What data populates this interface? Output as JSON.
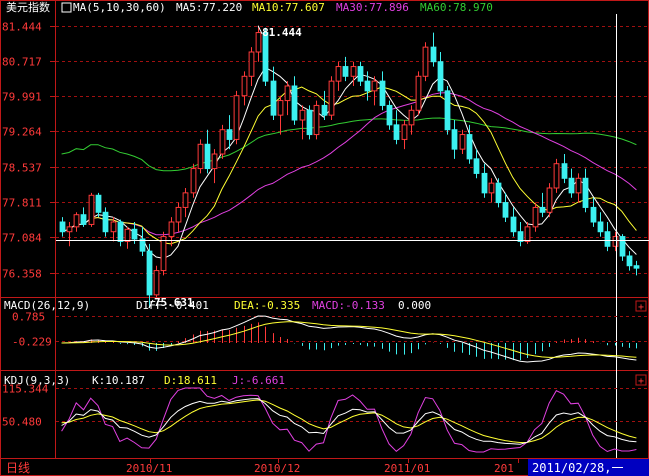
{
  "chart_data": {
    "type": "candlestick",
    "instrument": "美元指数",
    "panels": {
      "price": {
        "header": {
          "name": "美元指数",
          "ma_label": "MA(5,10,30,60)",
          "ma5": "MA5:77.220",
          "ma10": "MA10:77.607",
          "ma30": "MA30:77.896",
          "ma60": "MA60:78.970"
        },
        "y_ticks": [
          "81.444",
          "80.717",
          "79.991",
          "79.264",
          "78.537",
          "77.811",
          "77.084",
          "76.358"
        ],
        "y_range": [
          76.0,
          81.6
        ],
        "high_label": "81.444",
        "low_label": "75.631"
      },
      "macd": {
        "header": {
          "name": "MACD(26,12,9)",
          "diff": "DIFF:-0.401",
          "dea": "DEA:-0.335",
          "macd": "MACD:-0.133",
          "extra": "0.000"
        },
        "y_ticks": [
          "0.785",
          "-0.229"
        ]
      },
      "kdj": {
        "header": {
          "name": "KDJ(9,3,3)",
          "k": "K:10.187",
          "d": "D:18.611",
          "j": "J:-6.661"
        },
        "y_ticks": [
          "115.344",
          "50.480"
        ]
      }
    },
    "x_tick_labels": [
      "2010/11",
      "2010/12",
      "2011/01",
      "201"
    ],
    "cursor_date": "2011/02/28,一",
    "period_label": "日线",
    "candles_ohlc": [
      [
        77.4,
        77.5,
        77.1,
        77.2
      ],
      [
        77.2,
        77.4,
        76.9,
        77.3
      ],
      [
        77.3,
        77.6,
        77.2,
        77.55
      ],
      [
        77.55,
        77.7,
        77.3,
        77.35
      ],
      [
        77.35,
        78.0,
        77.3,
        77.95
      ],
      [
        77.95,
        78.0,
        77.5,
        77.6
      ],
      [
        77.6,
        77.7,
        77.1,
        77.2
      ],
      [
        77.2,
        77.5,
        77.0,
        77.4
      ],
      [
        77.4,
        77.45,
        76.9,
        77.0
      ],
      [
        77.0,
        77.3,
        76.85,
        77.25
      ],
      [
        77.25,
        77.4,
        76.95,
        77.05
      ],
      [
        77.05,
        77.3,
        76.7,
        76.8
      ],
      [
        76.8,
        76.95,
        75.63,
        75.9
      ],
      [
        75.9,
        76.5,
        75.85,
        76.4
      ],
      [
        76.4,
        77.2,
        76.3,
        77.1
      ],
      [
        77.1,
        77.5,
        76.9,
        77.4
      ],
      [
        77.4,
        77.8,
        77.2,
        77.7
      ],
      [
        77.7,
        78.1,
        77.5,
        78.0
      ],
      [
        78.0,
        78.6,
        77.9,
        78.5
      ],
      [
        78.5,
        79.1,
        78.4,
        79.0
      ],
      [
        79.0,
        79.3,
        78.4,
        78.5
      ],
      [
        78.5,
        78.9,
        78.2,
        78.8
      ],
      [
        78.8,
        79.4,
        78.7,
        79.3
      ],
      [
        79.3,
        79.6,
        78.9,
        79.1
      ],
      [
        79.1,
        80.1,
        79.0,
        80.0
      ],
      [
        80.0,
        80.5,
        79.8,
        80.4
      ],
      [
        80.4,
        81.0,
        80.2,
        80.9
      ],
      [
        80.9,
        81.44,
        80.7,
        81.3
      ],
      [
        81.3,
        81.4,
        80.2,
        80.3
      ],
      [
        80.3,
        80.6,
        79.5,
        79.6
      ],
      [
        79.6,
        80.0,
        79.2,
        79.9
      ],
      [
        79.9,
        80.3,
        79.6,
        80.2
      ],
      [
        80.2,
        80.4,
        79.4,
        79.5
      ],
      [
        79.5,
        79.8,
        79.1,
        79.7
      ],
      [
        79.7,
        79.8,
        79.1,
        79.2
      ],
      [
        79.2,
        79.9,
        79.1,
        79.8
      ],
      [
        79.8,
        80.1,
        79.5,
        79.6
      ],
      [
        79.6,
        80.4,
        79.5,
        80.3
      ],
      [
        80.3,
        80.7,
        80.1,
        80.6
      ],
      [
        80.6,
        80.8,
        80.3,
        80.4
      ],
      [
        80.4,
        80.7,
        80.2,
        80.6
      ],
      [
        80.6,
        80.7,
        80.2,
        80.3
      ],
      [
        80.3,
        80.5,
        79.9,
        80.1
      ],
      [
        80.1,
        80.4,
        79.8,
        80.3
      ],
      [
        80.3,
        80.5,
        79.7,
        79.8
      ],
      [
        79.8,
        79.9,
        79.3,
        79.4
      ],
      [
        79.4,
        79.7,
        79.0,
        79.1
      ],
      [
        79.1,
        79.5,
        78.9,
        79.4
      ],
      [
        79.4,
        79.8,
        79.2,
        79.7
      ],
      [
        79.7,
        80.5,
        79.6,
        80.4
      ],
      [
        80.4,
        81.1,
        80.3,
        81.0
      ],
      [
        81.0,
        81.3,
        80.6,
        80.7
      ],
      [
        80.7,
        80.9,
        80.0,
        80.1
      ],
      [
        80.1,
        80.2,
        79.2,
        79.3
      ],
      [
        79.3,
        79.5,
        78.7,
        78.9
      ],
      [
        78.9,
        79.3,
        78.8,
        79.2
      ],
      [
        79.2,
        79.4,
        78.6,
        78.7
      ],
      [
        78.7,
        78.9,
        78.3,
        78.4
      ],
      [
        78.4,
        78.6,
        77.9,
        78.0
      ],
      [
        78.0,
        78.3,
        77.8,
        78.2
      ],
      [
        78.2,
        78.3,
        77.7,
        77.8
      ],
      [
        77.8,
        78.0,
        77.4,
        77.5
      ],
      [
        77.5,
        77.7,
        77.1,
        77.2
      ],
      [
        77.2,
        77.4,
        76.9,
        77.0
      ],
      [
        77.0,
        77.4,
        76.95,
        77.3
      ],
      [
        77.3,
        77.8,
        77.2,
        77.7
      ],
      [
        77.7,
        78.0,
        77.5,
        77.6
      ],
      [
        77.6,
        78.2,
        77.5,
        78.1
      ],
      [
        78.1,
        78.7,
        78.0,
        78.6
      ],
      [
        78.6,
        78.8,
        78.2,
        78.3
      ],
      [
        78.3,
        78.5,
        77.9,
        78.0
      ],
      [
        78.0,
        78.4,
        77.8,
        78.3
      ],
      [
        78.3,
        78.5,
        77.6,
        77.7
      ],
      [
        77.7,
        77.9,
        77.3,
        77.4
      ],
      [
        77.4,
        77.6,
        77.1,
        77.2
      ],
      [
        77.2,
        77.4,
        76.8,
        76.9
      ],
      [
        76.9,
        77.2,
        76.8,
        77.1
      ],
      [
        77.1,
        77.15,
        76.6,
        76.7
      ],
      [
        76.7,
        76.8,
        76.4,
        76.5
      ],
      [
        76.5,
        76.6,
        76.3,
        76.45
      ]
    ]
  },
  "colors": {
    "up": "#ff3a3a",
    "down": "#3cf0f0",
    "ma5": "#ffffff",
    "ma10": "#ffff33",
    "ma30": "#e040e0",
    "ma60": "#33cc33",
    "grid": "#a01010",
    "axis": "#c01818",
    "label": "#ff3a3a",
    "cursor_bg": "#0000c0"
  }
}
